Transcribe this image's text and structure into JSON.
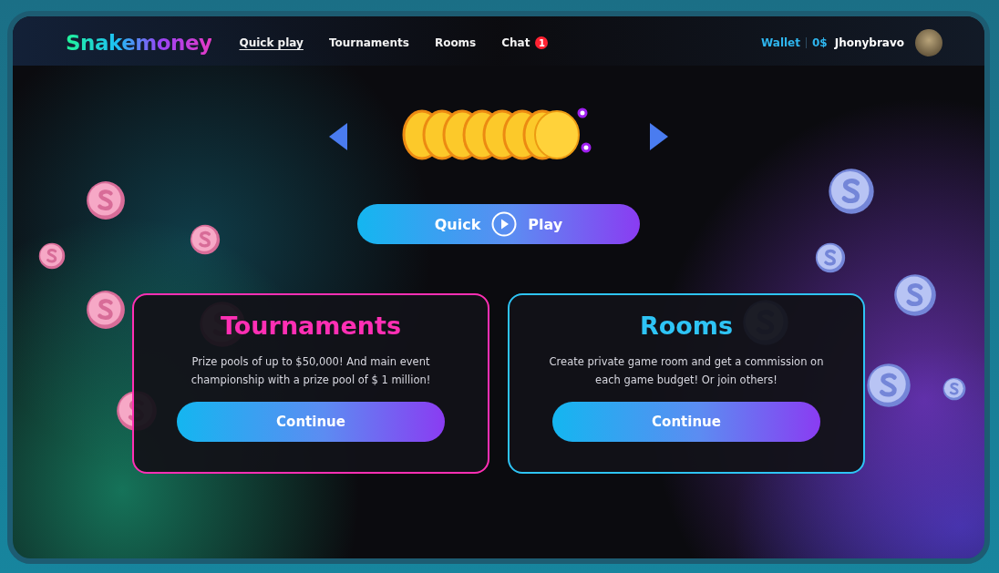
{
  "logo": "Snakemoney",
  "nav": [
    {
      "label": "Quick play",
      "selected": true
    },
    {
      "label": "Tournaments",
      "selected": false
    },
    {
      "label": "Rooms",
      "selected": false
    },
    {
      "label": "Chat",
      "selected": false,
      "badge": "1"
    }
  ],
  "wallet": {
    "label": "Wallet",
    "balance": "0$"
  },
  "user": {
    "name": "Jhonybravo"
  },
  "quick_play": {
    "left": "Quick",
    "right": "Play"
  },
  "cards": [
    {
      "title": "Tournaments",
      "color": "#ff2fb4",
      "text": "Prize pools of up to $50,000!  And main event championship with a prize pool of $ 1 million!",
      "button": "Continue"
    },
    {
      "title": "Rooms",
      "color": "#2ec4f5",
      "text": "Create private game room and get a commission on each game budget! Or join others!",
      "button": "Continue"
    }
  ]
}
